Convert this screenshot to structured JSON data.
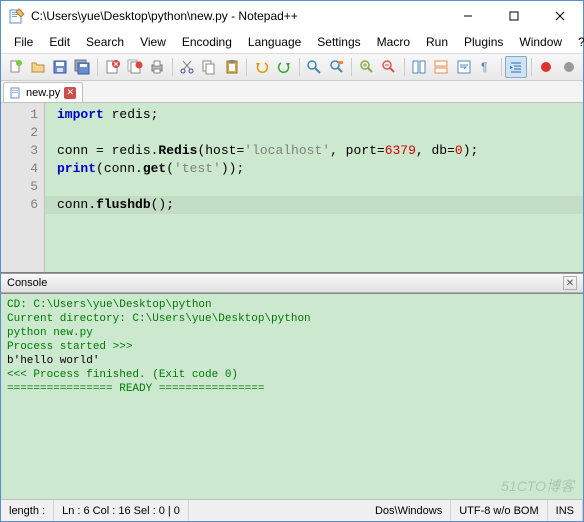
{
  "window": {
    "title": "C:\\Users\\yue\\Desktop\\python\\new.py - Notepad++"
  },
  "menu": {
    "items": [
      "File",
      "Edit",
      "Search",
      "View",
      "Encoding",
      "Language",
      "Settings",
      "Macro",
      "Run",
      "Plugins",
      "Window",
      "?"
    ]
  },
  "tab": {
    "filename": "new.py"
  },
  "code": {
    "lines": [
      {
        "n": "1",
        "segs": [
          {
            "t": "import",
            "c": "kw"
          },
          {
            "t": " redis;",
            "c": ""
          }
        ]
      },
      {
        "n": "2",
        "segs": []
      },
      {
        "n": "3",
        "segs": [
          {
            "t": "conn = redis.",
            "c": ""
          },
          {
            "t": "Redis",
            "c": "fn"
          },
          {
            "t": "(host=",
            "c": ""
          },
          {
            "t": "'localhost'",
            "c": "str"
          },
          {
            "t": ", port=",
            "c": ""
          },
          {
            "t": "6379",
            "c": "num"
          },
          {
            "t": ", db=",
            "c": ""
          },
          {
            "t": "0",
            "c": "num"
          },
          {
            "t": ");",
            "c": ""
          }
        ]
      },
      {
        "n": "4",
        "segs": [
          {
            "t": "print",
            "c": "kw"
          },
          {
            "t": "(conn.",
            "c": ""
          },
          {
            "t": "get",
            "c": "fn"
          },
          {
            "t": "(",
            "c": ""
          },
          {
            "t": "'test'",
            "c": "str"
          },
          {
            "t": "));",
            "c": ""
          }
        ]
      },
      {
        "n": "5",
        "segs": []
      },
      {
        "n": "6",
        "segs": [
          {
            "t": "conn.",
            "c": ""
          },
          {
            "t": "flushdb",
            "c": "fn"
          },
          {
            "t": "();",
            "c": ""
          }
        ]
      }
    ]
  },
  "console": {
    "title": "Console",
    "lines": [
      {
        "t": "CD: C:\\Users\\yue\\Desktop\\python",
        "c": "g"
      },
      {
        "t": "Current directory: C:\\Users\\yue\\Desktop\\python",
        "c": "g"
      },
      {
        "t": "python new.py",
        "c": "g"
      },
      {
        "t": "Process started >>>",
        "c": "g"
      },
      {
        "t": "b'hello world'",
        "c": "plain"
      },
      {
        "t": "<<< Process finished. (Exit code 0)",
        "c": "g"
      },
      {
        "t": "================ READY ================",
        "c": "g"
      }
    ]
  },
  "status": {
    "length": "length :",
    "pos": "Ln : 6    Col : 16    Sel : 0 | 0",
    "eol": "Dos\\Windows",
    "enc": "UTF-8 w/o BOM",
    "mode": "INS"
  },
  "watermark": "51CTO博客"
}
